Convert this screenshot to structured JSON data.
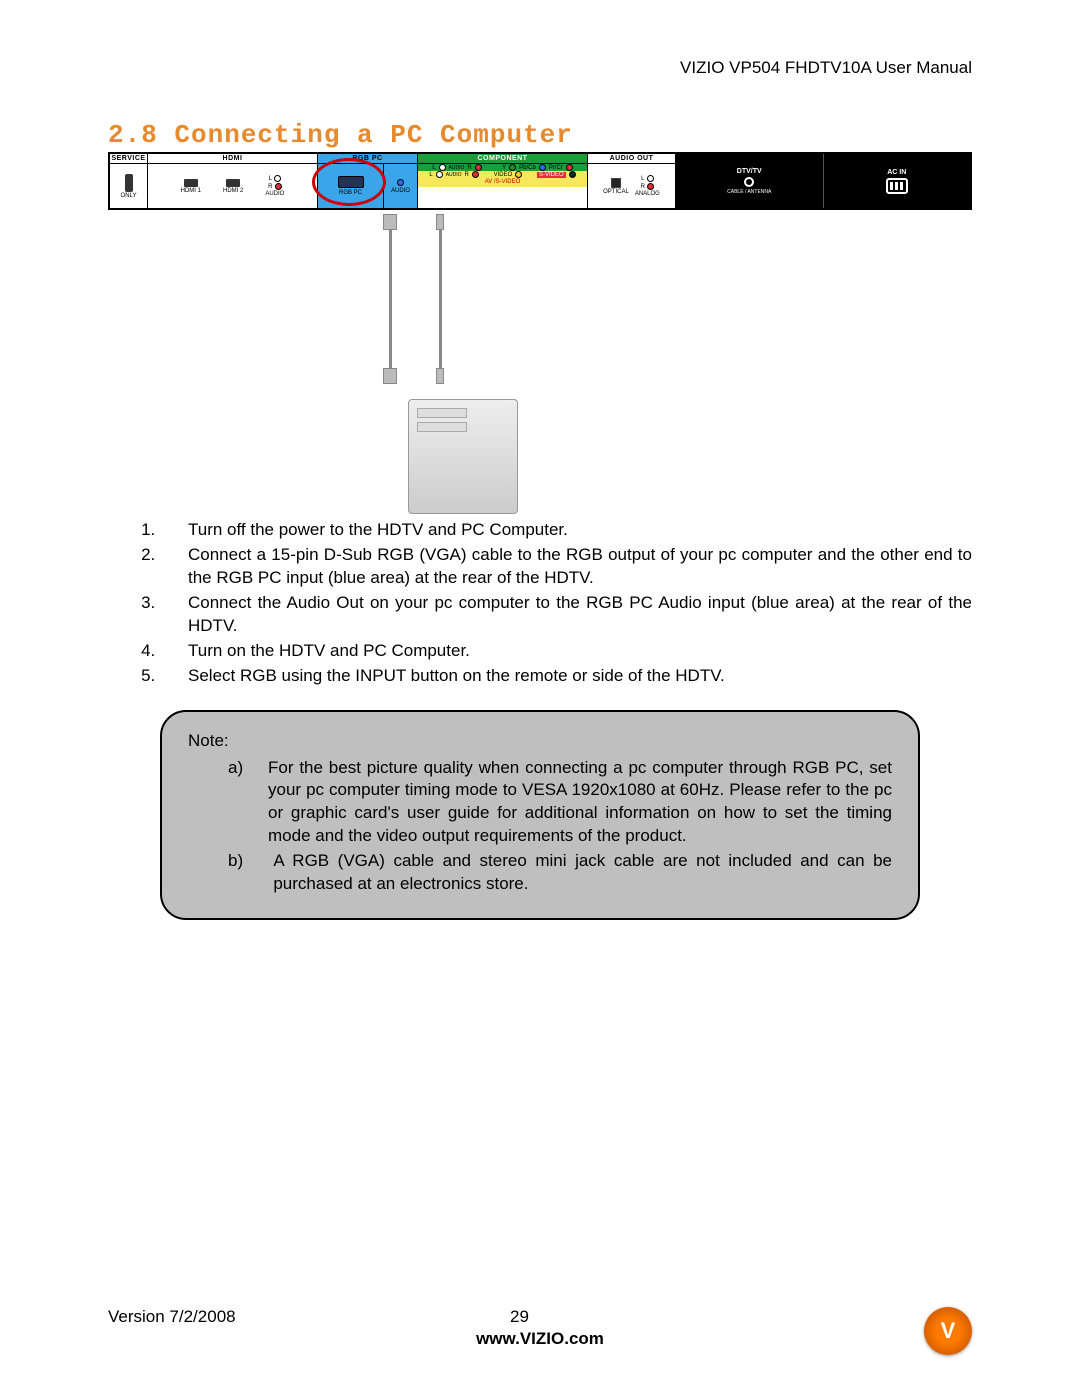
{
  "header": {
    "manual_title": "VIZIO VP504 FHDTV10A User Manual"
  },
  "section": {
    "number_title": "2.8 Connecting a PC Computer"
  },
  "panel": {
    "service": {
      "header": "SERVICE",
      "sub": "ONLY"
    },
    "hdmi": {
      "header": "HDMI",
      "p1": "HDMI 1",
      "p2": "HDMI 2"
    },
    "audio_lr": {
      "l": "L",
      "r": "R",
      "sub": "AUDIO"
    },
    "rgbpc": {
      "header": "RGB PC",
      "port": "RGB PC",
      "audio": "AUDIO"
    },
    "component": {
      "header": "COMPONENT",
      "audio_l": "L",
      "audio_pref": "AUDIO",
      "audio_r": "R",
      "y": "Y",
      "pbcb": "Pb/Cb",
      "prcr": "Pr/Cr",
      "video": "VIDEO",
      "svideo": "S-VIDEO",
      "av_footer": "AV /S-VIDEO"
    },
    "audio_out": {
      "header": "AUDIO OUT",
      "l": "L",
      "r": "R",
      "optical": "OPTICAL",
      "analog": "ANALOG"
    },
    "black": {
      "dtv": "DTV/TV",
      "cable": "CABLE / ANTENNA",
      "acin": "AC IN"
    }
  },
  "steps": {
    "s1": "Turn off the power to the HDTV and PC Computer.",
    "s2": "Connect a 15-pin D-Sub RGB (VGA) cable to the RGB output of your pc computer and the other end to the RGB PC input (blue area) at the rear of the HDTV.",
    "s3": "Connect the Audio Out on your pc computer to the RGB PC Audio input (blue area) at the rear of the HDTV.",
    "s4": "Turn on the HDTV and PC Computer.",
    "s5": "Select RGB using the INPUT button on the remote or side of the HDTV."
  },
  "note": {
    "title": "Note:",
    "la": "a)",
    "a": "For the best picture quality when connecting a pc computer through RGB PC, set your pc computer timing mode to VESA 1920x1080 at 60Hz. Please refer to the pc or graphic card's user guide for additional information on how to set the timing mode and the video output requirements of the product.",
    "lb": "b)",
    "b": "A RGB (VGA) cable and stereo mini jack cable are not included and can be purchased at an electronics store."
  },
  "footer": {
    "version": "Version 7/2/2008",
    "page": "29",
    "url": "www.VIZIO.com",
    "logo_glyph": "V"
  }
}
